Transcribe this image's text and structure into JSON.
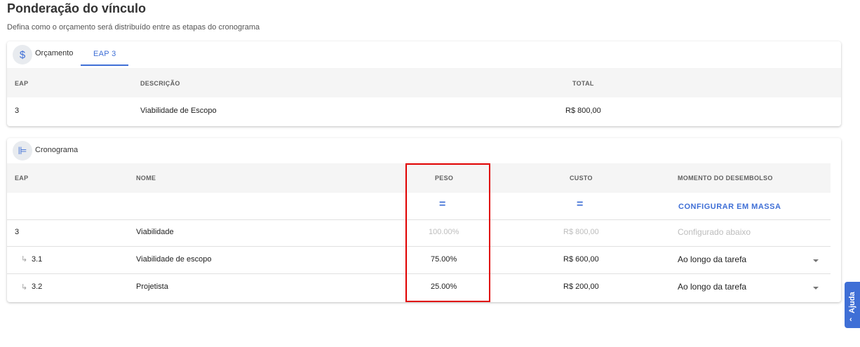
{
  "header": {
    "title": "Ponderação do vínculo",
    "subtitle": "Defina como o orçamento será distribuído entre as etapas do cronograma"
  },
  "budget_card": {
    "icon": "dollar-icon",
    "icon_glyph": "$",
    "label": "Orçamento",
    "tab": "EAP 3",
    "columns": {
      "eap": "EAP",
      "descricao": "DESCRIÇÃO",
      "total": "TOTAL"
    },
    "row": {
      "eap": "3",
      "descricao": "Viabilidade de Escopo",
      "total": "R$ 800,00"
    }
  },
  "schedule_card": {
    "icon": "gantt-icon",
    "icon_glyph": "⊫",
    "label": "Cronograma",
    "columns": {
      "eap": "EAP",
      "nome": "NOME",
      "peso": "PESO",
      "custo": "CUSTO",
      "momento": "MOMENTO DO DESEMBOLSO"
    },
    "bulk": {
      "peso_symbol": "=",
      "custo_symbol": "=",
      "mass_config": "CONFIGURAR EM MASSA"
    },
    "rows": [
      {
        "eap": "3",
        "nome": "Viabilidade",
        "peso": "100.00%",
        "custo": "R$ 800,00",
        "momento": "Configurado abaixo"
      },
      {
        "eap": "3.1",
        "nome": "Viabilidade de escopo",
        "peso": "75.00%",
        "custo": "R$ 600,00",
        "momento": "Ao longo da tarefa"
      },
      {
        "eap": "3.2",
        "nome": "Projetista",
        "peso": "25.00%",
        "custo": "R$ 200,00",
        "momento": "Ao longo da tarefa"
      }
    ],
    "sub_arrow": "↳"
  },
  "help": {
    "label": "Ajuda",
    "chevron": "‹"
  },
  "colors": {
    "accent": "#3f6fd6",
    "highlight": "#e00000"
  }
}
